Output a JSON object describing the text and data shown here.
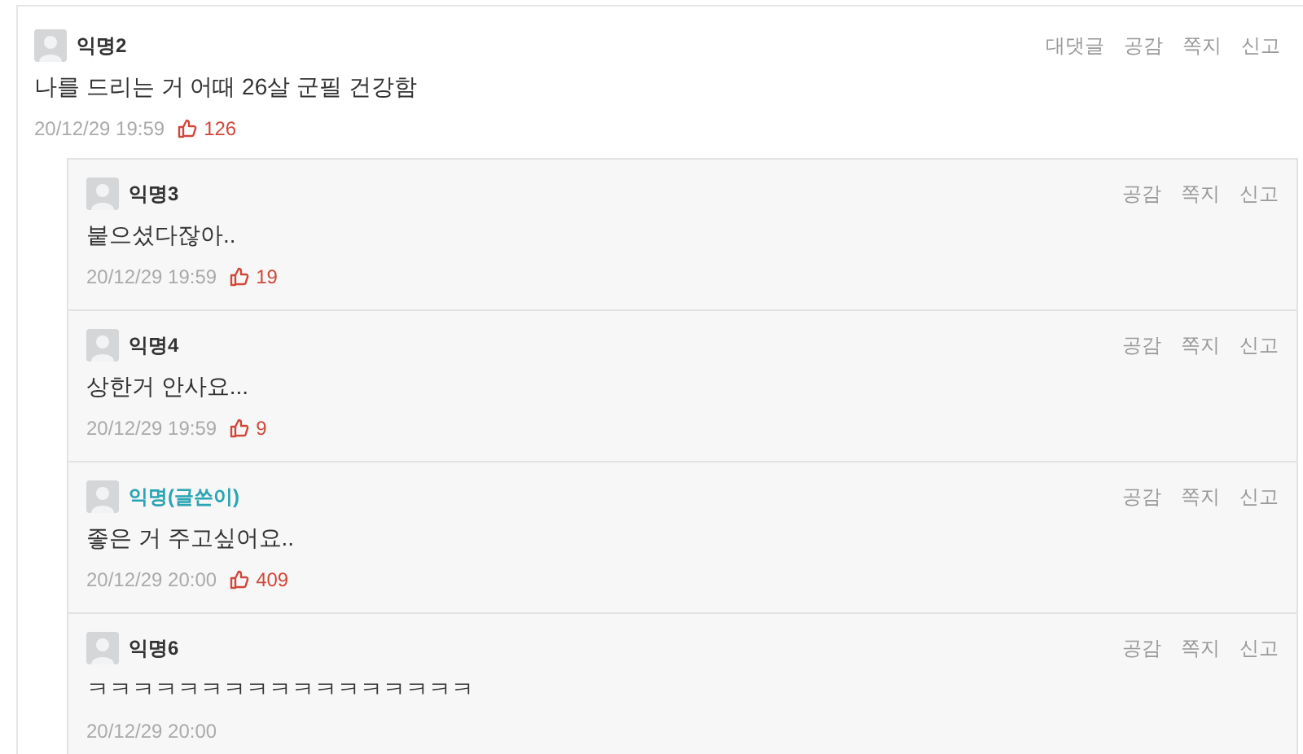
{
  "comment": {
    "author": "익명2",
    "is_writer": false,
    "actions": [
      "대댓글",
      "공감",
      "쪽지",
      "신고"
    ],
    "text": "나를 드리는 거 어때 26살 군필 건강함",
    "time": "20/12/29 19:59",
    "likes": "126"
  },
  "replies": [
    {
      "author": "익명3",
      "is_writer": false,
      "actions": [
        "공감",
        "쪽지",
        "신고"
      ],
      "text": "붙으셨다잖아..",
      "time": "20/12/29 19:59",
      "likes": "19"
    },
    {
      "author": "익명4",
      "is_writer": false,
      "actions": [
        "공감",
        "쪽지",
        "신고"
      ],
      "text": "상한거 안사요...",
      "time": "20/12/29 19:59",
      "likes": "9"
    },
    {
      "author": "익명(글쓴이)",
      "is_writer": true,
      "actions": [
        "공감",
        "쪽지",
        "신고"
      ],
      "text": "좋은 거 주고싶어요..",
      "time": "20/12/29 20:00",
      "likes": "409"
    },
    {
      "author": "익명6",
      "is_writer": false,
      "actions": [
        "공감",
        "쪽지",
        "신고"
      ],
      "text": "ㅋㅋㅋㅋㅋㅋㅋㅋㅋㅋㅋㅋㅋㅋㅋㅋㅋ",
      "time": "20/12/29 20:00"
    }
  ]
}
